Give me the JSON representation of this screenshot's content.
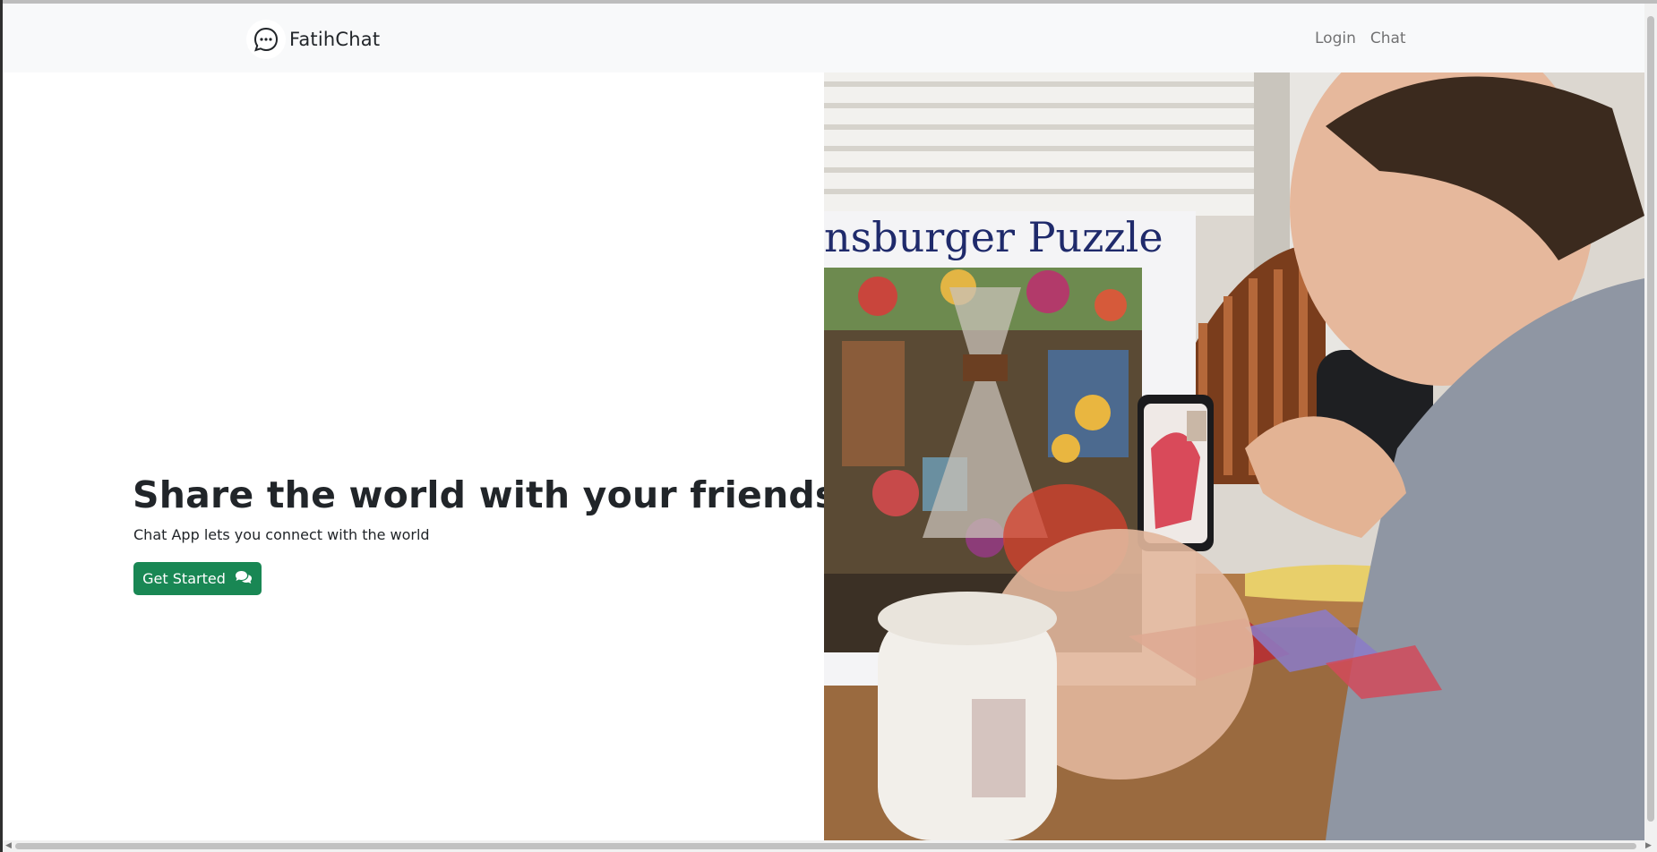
{
  "app": {
    "brand_name": "FatihChat",
    "brand_icon": "chat-bubble-dots-icon"
  },
  "nav": {
    "links": [
      {
        "label": "Login"
      },
      {
        "label": "Chat"
      }
    ]
  },
  "hero": {
    "headline": "Share the world with your friends",
    "subtext": "Chat App lets you connect with the world",
    "cta_label": "Get Started",
    "cta_icon": "comments-icon"
  },
  "image": {
    "puzzle_box_text": "nsburger Puzzle"
  },
  "colors": {
    "accent": "#198754",
    "navbar_bg": "#f8f9fa",
    "text": "#212529",
    "nav_link": "#7b7b7b"
  }
}
